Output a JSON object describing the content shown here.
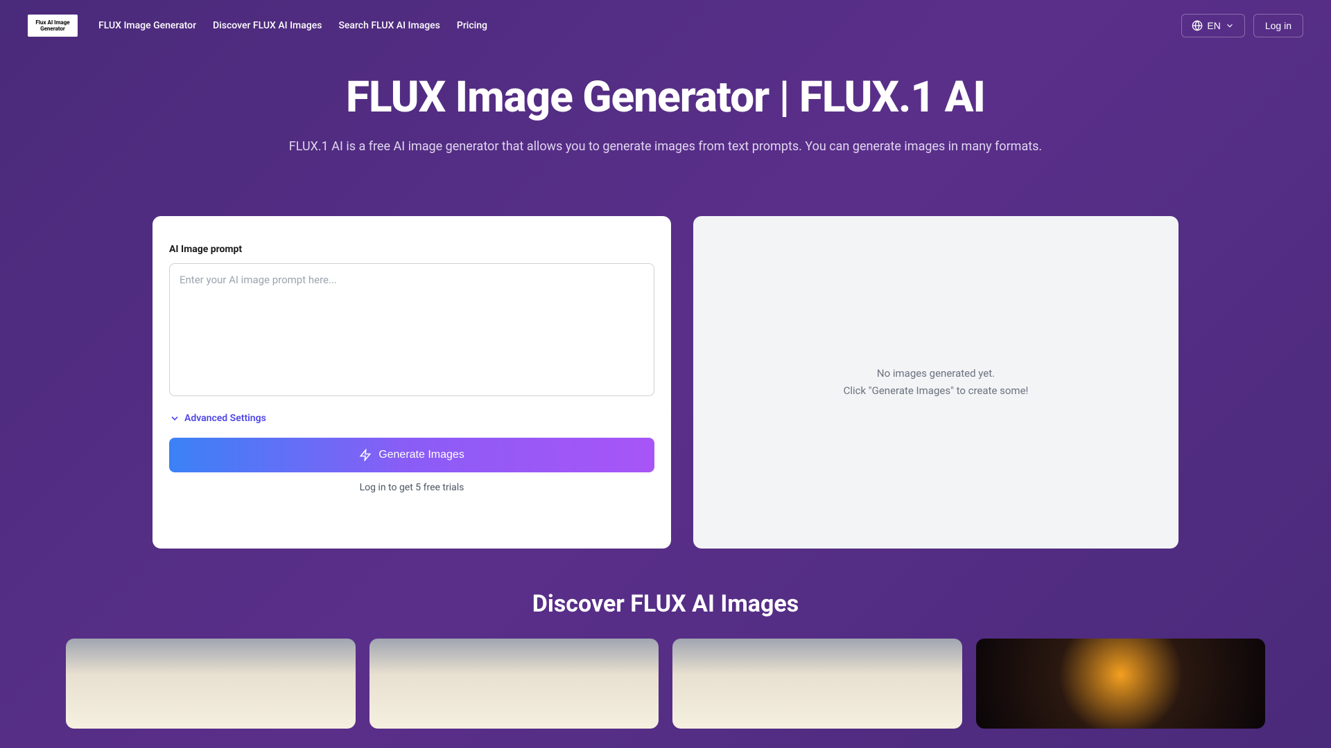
{
  "logo_text": "Flux AI Image Generator",
  "nav": {
    "links": [
      "FLUX Image Generator",
      "Discover FLUX AI Images",
      "Search FLUX AI Images",
      "Pricing"
    ],
    "lang": "EN",
    "login": "Log in"
  },
  "hero": {
    "title": "FLUX Image Generator | FLUX.1 AI",
    "subtitle": "FLUX.1 AI is a free AI image generator that allows you to generate images from text prompts. You can generate images in many formats."
  },
  "prompt_panel": {
    "label": "AI Image prompt",
    "placeholder": "Enter your AI image prompt here...",
    "advanced": "Advanced Settings",
    "generate_btn": "Generate Images",
    "trial_text": "Log in to get 5 free trials"
  },
  "output_panel": {
    "line1": "No images generated yet.",
    "line2": "Click \"Generate Images\" to create some!"
  },
  "discover": {
    "title": "Discover FLUX AI Images"
  }
}
